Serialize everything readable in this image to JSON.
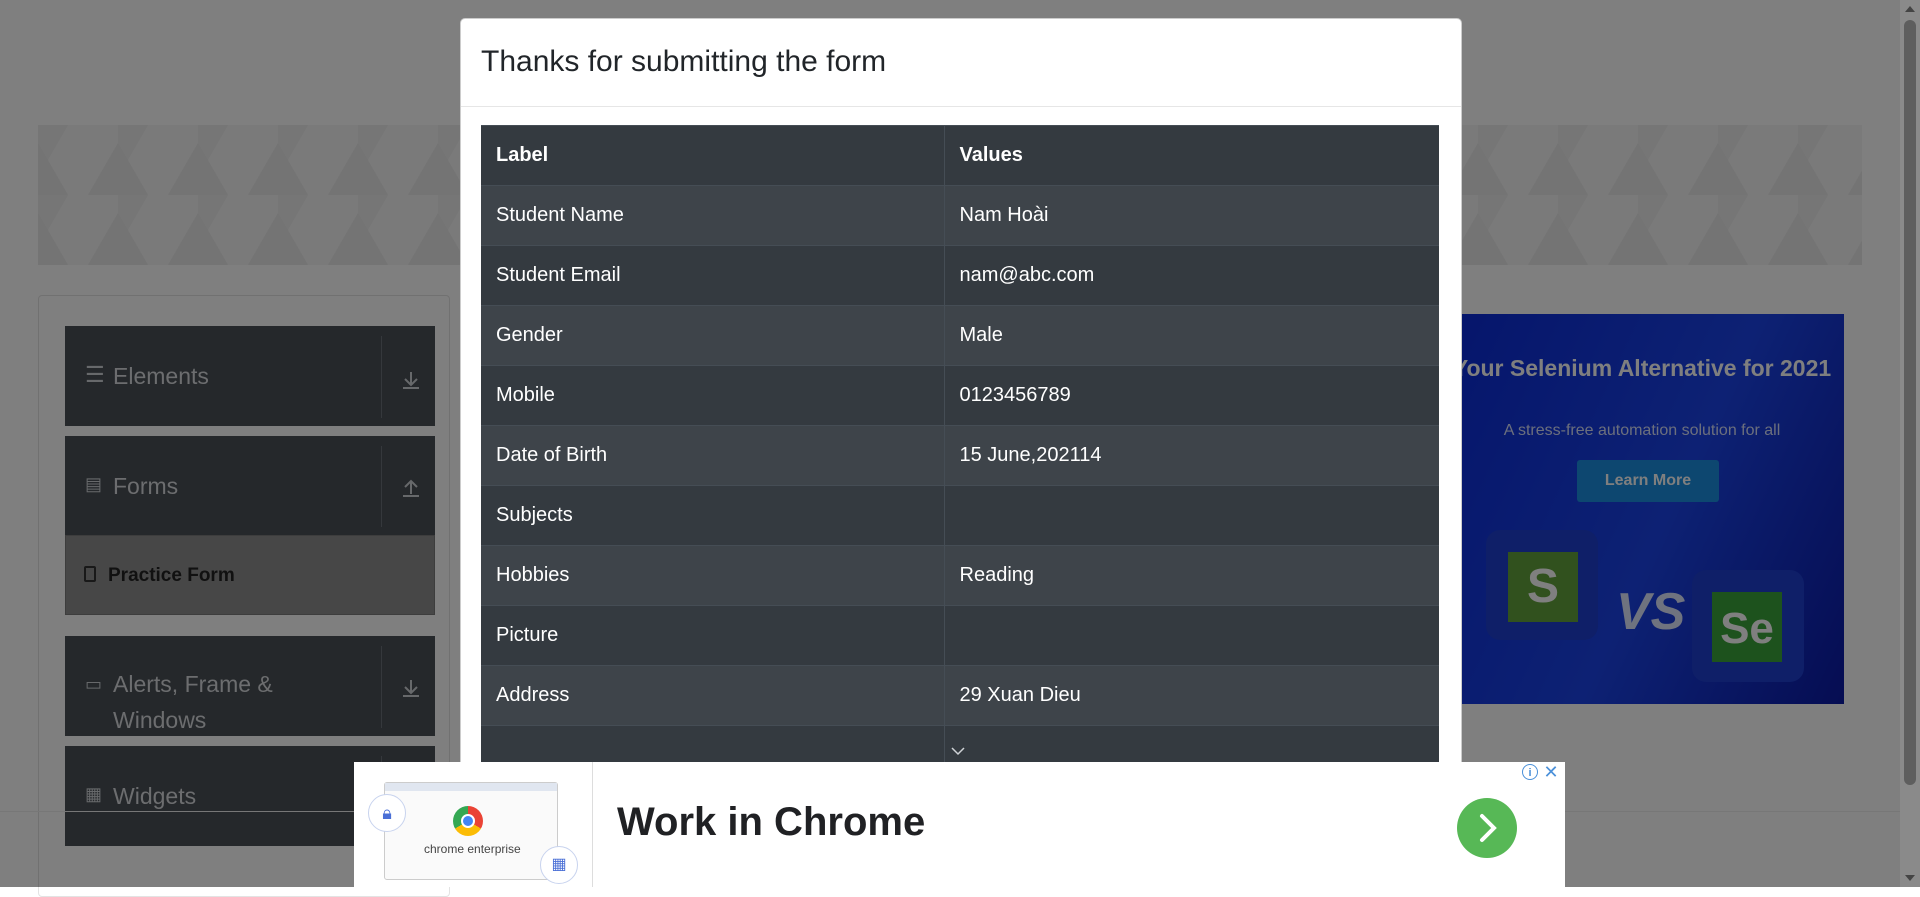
{
  "sidebar": {
    "groups": [
      {
        "label": "Elements"
      },
      {
        "label": "Forms"
      },
      {
        "label": "Alerts, Frame & Windows"
      },
      {
        "label": "Widgets"
      }
    ],
    "active_item": "Practice Form"
  },
  "side_ad": {
    "headline": "Your Selenium Alternative for 2021",
    "subtext": "A stress-free automation solution for all",
    "button": "Learn More",
    "vs": "VS"
  },
  "modal": {
    "title": "Thanks for submitting the form",
    "table": {
      "headers": [
        "Label",
        "Values"
      ],
      "rows": [
        {
          "label": "Student Name",
          "value": "Nam Hoài"
        },
        {
          "label": "Student Email",
          "value": "nam@abc.com"
        },
        {
          "label": "Gender",
          "value": "Male"
        },
        {
          "label": "Mobile",
          "value": "0123456789"
        },
        {
          "label": "Date of Birth",
          "value": "15 June,202114"
        },
        {
          "label": "Subjects",
          "value": ""
        },
        {
          "label": "Hobbies",
          "value": "Reading"
        },
        {
          "label": "Picture",
          "value": ""
        },
        {
          "label": "Address",
          "value": "29 Xuan Dieu"
        }
      ]
    }
  },
  "bottom_ad": {
    "headline": "Work in Chrome",
    "image_caption": "chrome enterprise",
    "info_icon": "i",
    "close_icon": "✕"
  }
}
